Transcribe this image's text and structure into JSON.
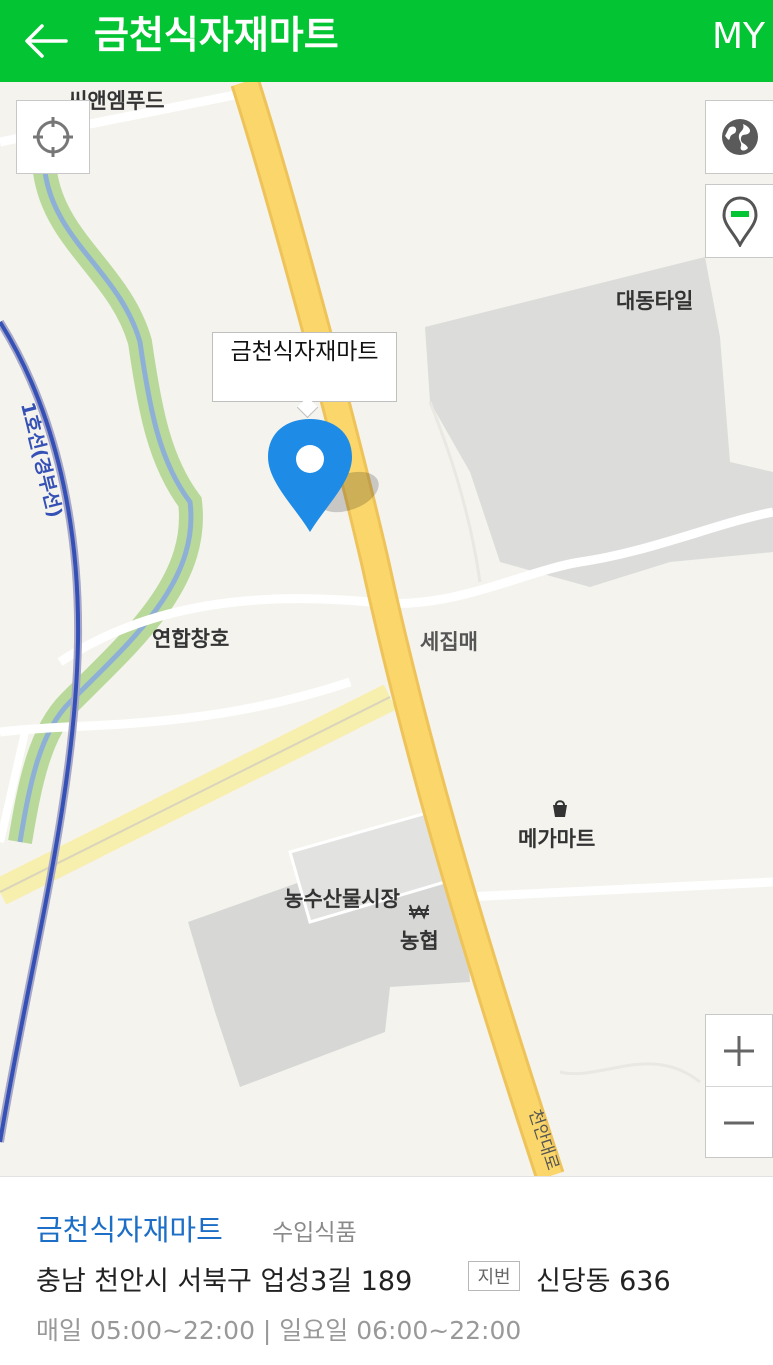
{
  "header": {
    "title": "금천식자재마트",
    "my_label": "MY",
    "background_color": "#03c432"
  },
  "map": {
    "labels": {
      "top_left_place": "씨앤엠푸드",
      "place_1": "대동타일",
      "place_2": "연합창호",
      "place_3": "세집매",
      "place_4": "메가마트",
      "place_5": "농수산물시장",
      "place_6": "농협",
      "road_label": "천안대로",
      "rail_label": "1호선(경부선)"
    },
    "marker_callout": "금천식자재마트",
    "controls": {
      "location_icon": "crosshair-icon",
      "globe_icon": "globe-icon",
      "pin_icon": "map-pin-icon",
      "zoom_in": "+",
      "zoom_out": "−"
    },
    "marker_color": "#1e8ce6"
  },
  "place": {
    "name": "금천식자재마트",
    "category": "수입식품",
    "address": "충남 천안시 서북구 업성3길 189",
    "jibun_badge": "지번",
    "jibun_address": "신당동 636",
    "hours": "매일 05:00~22:00 | 일요일 06:00~22:00"
  }
}
